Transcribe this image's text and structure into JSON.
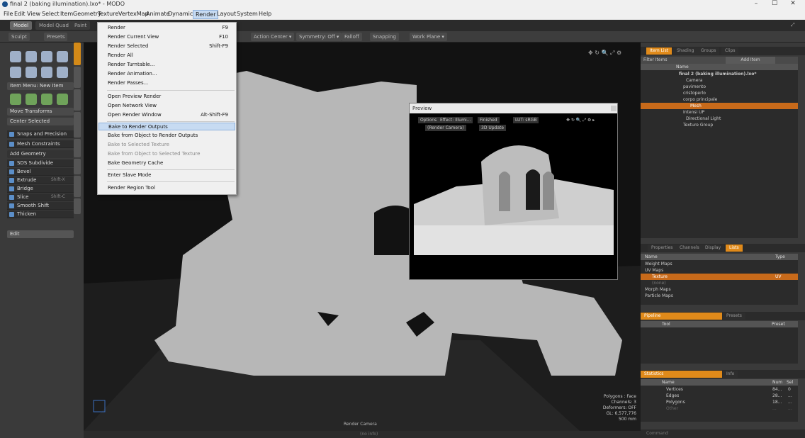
{
  "window": {
    "title": "final 2 (baking illumination).lxo* - MODO",
    "controls": [
      "–",
      "☐",
      "✕"
    ]
  },
  "menubar": [
    "File",
    "Edit",
    "View",
    "Select",
    "Item",
    "Geometry",
    "Texture",
    "VertexMap",
    "Animate",
    "Dynamics",
    "Render",
    "Layout",
    "System",
    "Help"
  ],
  "menubar_active": "Render",
  "modes": [
    "Model",
    "Model Quad",
    "Paint"
  ],
  "toolbar": {
    "sculpt": "Sculpt",
    "presets": "Presets",
    "action_center": "Action Center ▾",
    "symmetry": "Symmetry: Off ▾",
    "falloff": "Falloff",
    "snapping": "Snapping",
    "work_plane": "Work Plane ▾"
  },
  "left": {
    "item_menu": "Item Menu: New Item",
    "move_transforms": "Move Transforms",
    "center_selected": "Center Selected",
    "snaps": "Snaps and Precision",
    "mesh_constraints": "Mesh Constraints",
    "add_geometry": "Add Geometry",
    "tools": [
      "SDS Subdivide",
      "Bevel",
      "Extrude",
      "Bridge",
      "Slice",
      "Smooth Shift",
      "Thicken"
    ],
    "tool_keys": [
      "",
      "",
      "Shift-X",
      "",
      "Shift-C",
      "",
      ""
    ],
    "edit": "Edit"
  },
  "render_menu": {
    "items": [
      {
        "label": "Render",
        "key": "F9"
      },
      {
        "label": "Render Current View",
        "key": "F10"
      },
      {
        "label": "Render Selected",
        "key": "Shift-F9"
      },
      {
        "label": "Render All",
        "key": ""
      },
      {
        "label": "Render Turntable...",
        "key": ""
      },
      {
        "label": "Render Animation...",
        "key": ""
      },
      {
        "label": "Render Passes...",
        "key": ""
      },
      {
        "label": "Open Preview Render",
        "key": ""
      },
      {
        "label": "Open Network View",
        "key": ""
      },
      {
        "label": "Open Render Window",
        "key": "Alt-Shift-F9"
      },
      {
        "label": "Bake to Render Outputs",
        "key": ""
      },
      {
        "label": "Bake from Object to Render Outputs",
        "key": ""
      },
      {
        "label": "Bake to Selected Texture",
        "key": ""
      },
      {
        "label": "Bake from Object to Selected Texture",
        "key": ""
      },
      {
        "label": "Bake Geometry Cache",
        "key": ""
      },
      {
        "label": "Enter Slave Mode",
        "key": ""
      },
      {
        "label": "Render Region Tool",
        "key": ""
      }
    ],
    "highlighted": "Bake to Render Outputs"
  },
  "preview": {
    "title": "Preview",
    "options": "Options",
    "effect": "Effect: Illumi...",
    "finished": "Finished",
    "lut": "LUT: sRGB",
    "camera": "(Render Camera)",
    "update": "3D Update"
  },
  "viewport": {
    "camera_label": "Render Camera",
    "info": [
      "Polygons : Face",
      "Channels: 3",
      "Deformers: OFF",
      "GL: 6,577,776",
      "500 mm"
    ],
    "status": "(no info)"
  },
  "items_panel": {
    "tabs": [
      "Item List",
      "Shading",
      "Groups",
      "Clips"
    ],
    "filter": "Filter Items",
    "add_item": "Add Item",
    "col_name": "Name",
    "rows": [
      "final 2 (baking illumination).lxo*",
      "Camera",
      "pavimento",
      "cristoperlo",
      "corpo principale",
      "Mesh",
      "Intensi UP",
      "Directional Light",
      "Texture Group"
    ]
  },
  "props_panel": {
    "tabs": [
      "Properties",
      "Channels",
      "Display",
      "Lists"
    ],
    "col_name": "Name",
    "col_type": "Type",
    "rows": [
      "Weight Maps",
      "UV Maps",
      "Texture",
      "(none)",
      "Morph Maps",
      "Particle Maps"
    ],
    "type_val": "UV"
  },
  "pipeline": {
    "tabs": [
      "Pipeline",
      "Presets"
    ],
    "col_tool": "Tool",
    "col_preset": "Preset"
  },
  "stats": {
    "tabs": [
      "Statistics",
      "Info"
    ],
    "col_name": "Name",
    "col_num": "Num",
    "col_sel": "Sel",
    "rows": [
      {
        "label": "Vertices",
        "num": "84...",
        "sel": "0"
      },
      {
        "label": "Edges",
        "num": "28...",
        "sel": "..."
      },
      {
        "label": "Polygons",
        "num": "18...",
        "sel": "..."
      },
      {
        "label": "Other",
        "num": "...",
        "sel": "..."
      }
    ]
  },
  "command": "Command"
}
